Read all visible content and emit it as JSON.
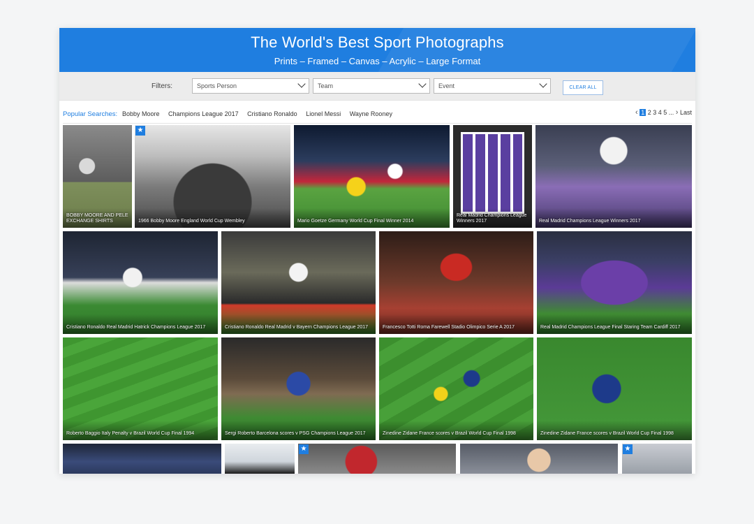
{
  "header": {
    "title": "The World's Best Sport Photographs",
    "subtitle": "Prints – Framed – Canvas – Acrylic – Large Format"
  },
  "filters": {
    "label": "Filters:",
    "sports_person": "Sports Person",
    "team": "Team",
    "event": "Event",
    "clear_all": "CLEAR ALL"
  },
  "popular": {
    "label": "Popular Searches:",
    "tags": [
      "Bobby Moore",
      "Champions League 2017",
      "Cristiano Ronaldo",
      "Lionel Messi",
      "Wayne Rooney"
    ]
  },
  "pager": {
    "prev": "‹",
    "current": "1",
    "pages": "2 3 4 5 ...",
    "next": "›",
    "last": "Last"
  },
  "tiles": [
    {
      "caption": "BOBBY MOORE AND PELE EXCHANGE SHIRTS",
      "featured": false
    },
    {
      "caption": "1966 Bobby Moore England World Cup Wembley",
      "featured": true
    },
    {
      "caption": "Mario Goetze Germany World Cup Final Winner 2014",
      "featured": false
    },
    {
      "caption": "Real Madrid Champions League Winners 2017",
      "featured": false
    },
    {
      "caption": "Real Madrid Champions League Winners 2017",
      "featured": false
    },
    {
      "caption": "Cristiano Ronaldo Real Madrid Hatrick Champions League 2017",
      "featured": false
    },
    {
      "caption": "Cristiano Ronaldo Real Madrid v Bayern Champions League 2017",
      "featured": false
    },
    {
      "caption": "Francesco Totti Roma Farewell Stadio Olimpico Serie A 2017",
      "featured": false
    },
    {
      "caption": "Real Madrid Champions League Final Staring Team Cardiff 2017",
      "featured": false
    },
    {
      "caption": "Roberto Baggio Italy Penalty v Brazil World Cup Final 1994",
      "featured": false
    },
    {
      "caption": "Sergi Roberto Barcelona scores v PSG Champions League 2017",
      "featured": false
    },
    {
      "caption": "Zinedine Zidane France scores v Brazil World Cup Final 1998",
      "featured": false
    },
    {
      "caption": "Zinedine Zidane France scores v Brazil World Cup Final 1998",
      "featured": false
    }
  ]
}
